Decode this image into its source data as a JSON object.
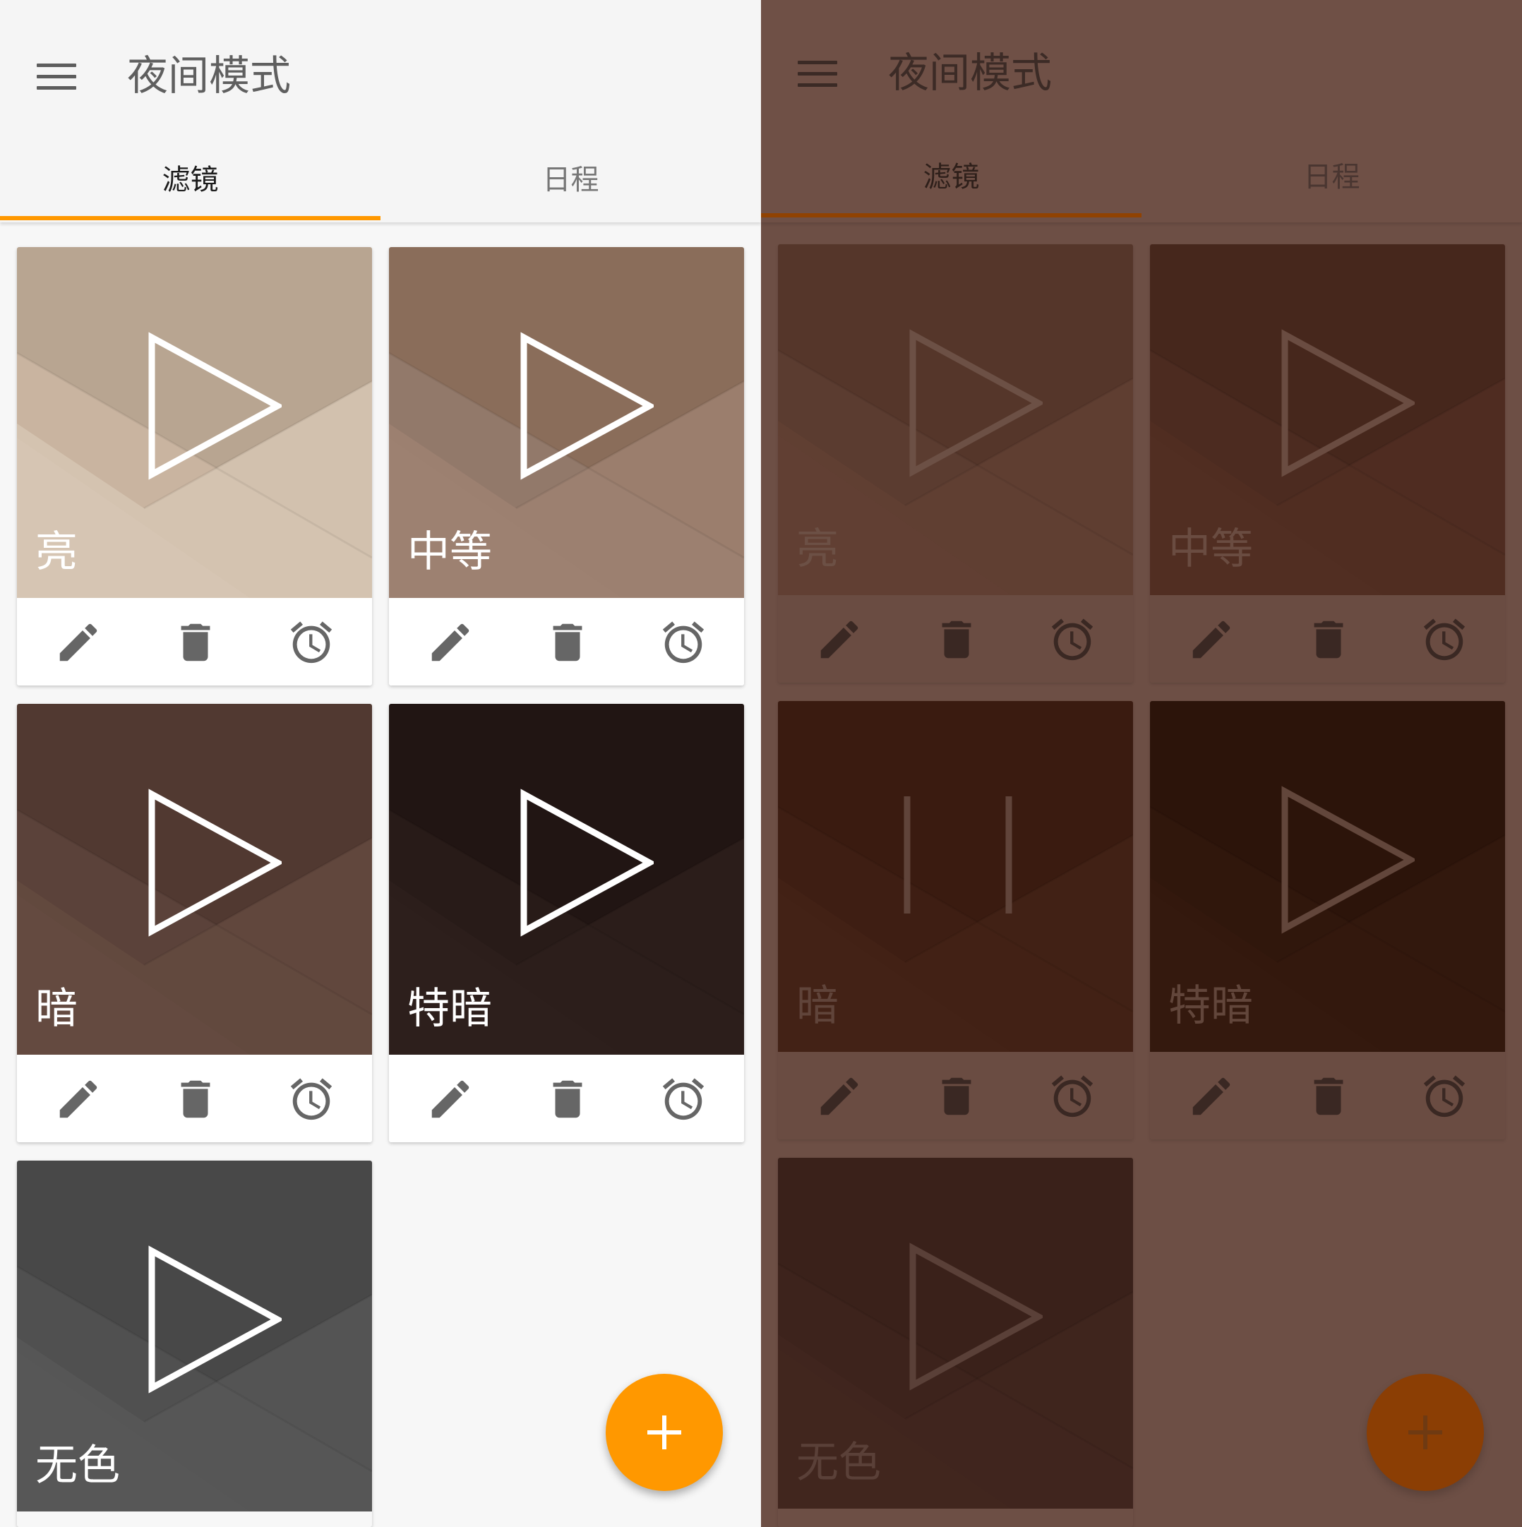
{
  "app": {
    "title": "夜间模式",
    "tabs": [
      {
        "label": "滤镜",
        "active": true
      },
      {
        "label": "日程",
        "active": false
      }
    ]
  },
  "light_panel": {
    "filters": [
      {
        "label": "亮",
        "colors": [
          "#b8a591",
          "#c9b4a0",
          "#d6c5b3"
        ],
        "state": "play"
      },
      {
        "label": "中等",
        "colors": [
          "#8a6d5a",
          "#92796a",
          "#9d8171"
        ],
        "state": "play"
      },
      {
        "label": "暗",
        "colors": [
          "#513931",
          "#5b423a",
          "#644a40"
        ],
        "state": "play"
      },
      {
        "label": "特暗",
        "colors": [
          "#211513",
          "#281b18",
          "#2d1f1c"
        ],
        "state": "play"
      },
      {
        "label": "无色",
        "colors": [
          "#484848",
          "#505050",
          "#575757"
        ],
        "state": "play"
      }
    ],
    "icon_color": "#666666",
    "accent": "#ff9800"
  },
  "dark_panel": {
    "filters": [
      {
        "label": "亮",
        "colors": [
          "#55362a",
          "#5b3c30",
          "#613f33"
        ],
        "label_color": "#6c5045",
        "state": "play"
      },
      {
        "label": "中等",
        "colors": [
          "#46271c",
          "#4c2b20",
          "#512e22"
        ],
        "label_color": "#6a4c41",
        "state": "play"
      },
      {
        "label": "暗",
        "colors": [
          "#3a1b10",
          "#3e1e13",
          "#432216"
        ],
        "label_color": "#60443a",
        "state": "pause"
      },
      {
        "label": "特暗",
        "colors": [
          "#2c140a",
          "#30170c",
          "#34190e"
        ],
        "label_color": "#62463b",
        "state": "play"
      },
      {
        "label": "无色",
        "colors": [
          "#3a211a",
          "#3d231c",
          "#41261e"
        ],
        "label_color": "#5a4038",
        "state": "play"
      }
    ],
    "icon_color": "#3a2823",
    "accent": "#904202"
  },
  "actions": [
    {
      "name": "edit-icon"
    },
    {
      "name": "delete-icon"
    },
    {
      "name": "alarm-icon"
    }
  ],
  "fab": {
    "icon": "plus-icon"
  }
}
